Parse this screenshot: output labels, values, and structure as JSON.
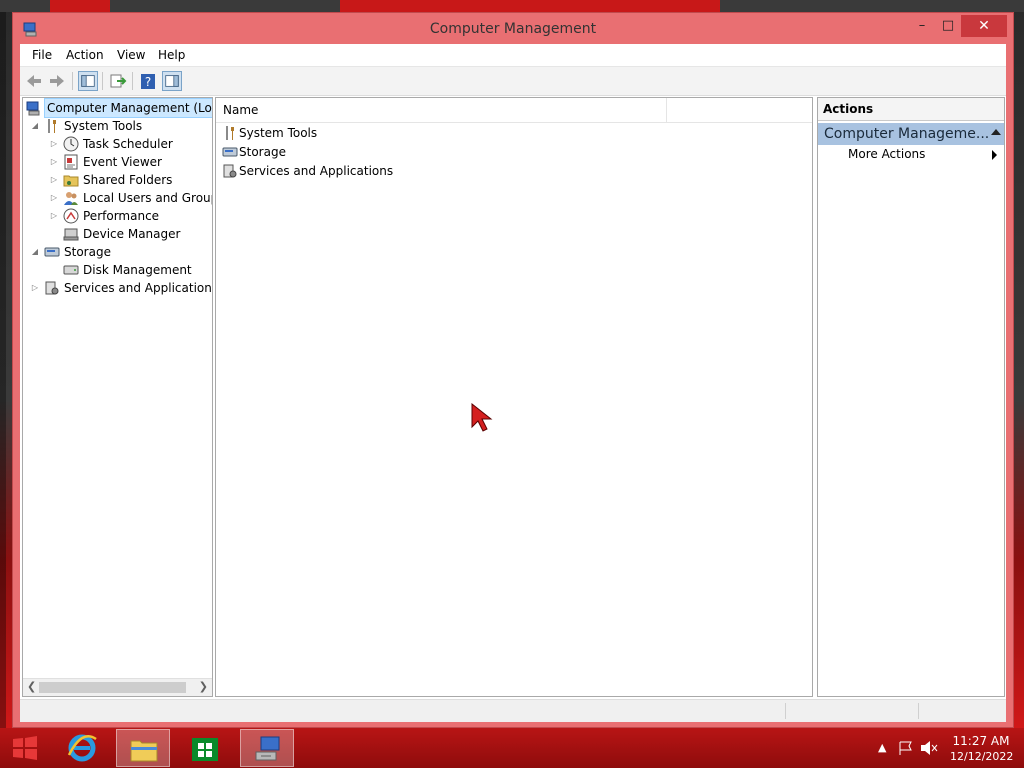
{
  "window": {
    "title": "Computer Management",
    "minimize": "–",
    "maximize": "□",
    "close": "✕"
  },
  "menu": [
    "File",
    "Action",
    "View",
    "Help"
  ],
  "toolbar": {
    "buttons": [
      "back-icon",
      "forward-icon",
      "show-hide-tree-icon",
      "export-list-icon",
      "help-icon",
      "show-hide-action-pane-icon"
    ]
  },
  "tree": {
    "root": "Computer Management (Local",
    "system_tools": "System Tools",
    "task_scheduler": "Task Scheduler",
    "event_viewer": "Event Viewer",
    "shared_folders": "Shared Folders",
    "local_users": "Local Users and Groups",
    "performance": "Performance",
    "device_manager": "Device Manager",
    "storage": "Storage",
    "disk_management": "Disk Management",
    "services": "Services and Applications"
  },
  "list": {
    "column": "Name",
    "items": [
      "System Tools",
      "Storage",
      "Services and Applications"
    ]
  },
  "actions": {
    "header": "Actions",
    "section": "Computer Manageme...",
    "more": "More Actions"
  },
  "taskbar": {
    "time": "11:27 AM",
    "date": "12/12/2022"
  },
  "colors": {
    "window_frame": "#e96f72",
    "close_button": "#c9383d",
    "taskbar": "#b81515",
    "selection": "#cce8ff",
    "actions_section": "#a8c2e0"
  }
}
